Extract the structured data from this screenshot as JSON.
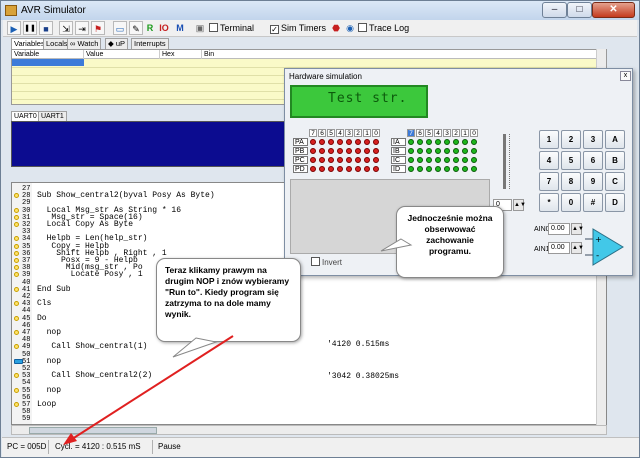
{
  "window": {
    "title": "AVR Simulator",
    "min": "–",
    "max": "□",
    "close": "✕"
  },
  "toolbar": {
    "play": "▶",
    "pause": "❚❚",
    "stop": "■",
    "rec": "R",
    "io": "IO",
    "mem": "M",
    "terminal": "Terminal",
    "sim_timers": "Sim Timers",
    "trace_log": "Trace Log",
    "sim_timers_checked": "✓"
  },
  "tabs": [
    "Variables",
    "Locals",
    "Watch",
    "uP",
    "Interrupts"
  ],
  "var_columns": [
    "Variable",
    "Value",
    "Hex",
    "Bin"
  ],
  "uart_tabs": [
    "UART0",
    "UART1"
  ],
  "code": {
    "lines": [
      {
        "n": "27",
        "t": ""
      },
      {
        "n": "28",
        "t": "Sub Show_central2(byval Posy As Byte)"
      },
      {
        "n": "29",
        "t": ""
      },
      {
        "n": "30",
        "t": "  Local Msg_str As String * 16"
      },
      {
        "n": "31",
        "t": "   Msg_str = Space(16)"
      },
      {
        "n": "32",
        "t": "  Local Copy As Byte"
      },
      {
        "n": "33",
        "t": ""
      },
      {
        "n": "34",
        "t": "  Helpb = Len(help_str)"
      },
      {
        "n": "35",
        "t": "   Copy = Helpb"
      },
      {
        "n": "36",
        "t": "    Shift Helpb , Right , 1"
      },
      {
        "n": "37",
        "t": "     Posx = 9 - Helpb"
      },
      {
        "n": "38",
        "t": "      Mid(msg_str , Po"
      },
      {
        "n": "39",
        "t": "       Locate Posy , 1"
      },
      {
        "n": "40",
        "t": ""
      },
      {
        "n": "41",
        "t": "End Sub"
      },
      {
        "n": "42",
        "t": ""
      },
      {
        "n": "43",
        "t": "Cls"
      },
      {
        "n": "44",
        "t": ""
      },
      {
        "n": "45",
        "t": "Do"
      },
      {
        "n": "46",
        "t": ""
      },
      {
        "n": "47",
        "t": "  nop"
      },
      {
        "n": "48",
        "t": ""
      },
      {
        "n": "49",
        "t": "   Call Show_central(1)"
      },
      {
        "n": "50",
        "t": ""
      },
      {
        "n": "51",
        "t": "  nop"
      },
      {
        "n": "52",
        "t": ""
      },
      {
        "n": "53",
        "t": "   Call Show_central2(2)"
      },
      {
        "n": "54",
        "t": ""
      },
      {
        "n": "55",
        "t": "  nop"
      },
      {
        "n": "56",
        "t": ""
      },
      {
        "n": "57",
        "t": "Loop"
      },
      {
        "n": "58",
        "t": ""
      },
      {
        "n": "59",
        "t": ""
      }
    ],
    "timing1": "'4120 0.515ms",
    "timing2": "'3042 0.38025ms"
  },
  "status": {
    "pc": "PC = 005D",
    "cycles": "Cycl. = 4120 : 0.515 mS",
    "state": "Pause"
  },
  "hw": {
    "title": "Hardware simulation",
    "close": "x",
    "lcd_text": "Test str.",
    "ports_left": [
      "PA",
      "PB",
      "PC",
      "PD"
    ],
    "ports_right": [
      "IA",
      "IB",
      "IC",
      "ID"
    ],
    "bits": [
      "7",
      "6",
      "5",
      "4",
      "3",
      "2",
      "1",
      "0"
    ],
    "invert": "Invert",
    "slider_value": "0",
    "keypad": [
      "1",
      "2",
      "3",
      "A",
      "4",
      "5",
      "6",
      "B",
      "7",
      "8",
      "9",
      "C",
      "*",
      "0",
      "#",
      "D"
    ],
    "ain0_label": "AIN0",
    "ain0_value": "0.00",
    "ain1_label": "AIN1",
    "ain1_value": "0.00",
    "plus": "+",
    "minus": "-"
  },
  "callouts": {
    "c1": "Jednocześnie można obserwować zachowanie programu.",
    "c2": "Teraz klikamy prawym na drugim NOP i znów wybieramy \"Run to\". Kiedy program się zatrzyma to na dole mamy wynik."
  },
  "colors": {
    "accent": "#3d7bd9",
    "uart_bg": "#0c0c90",
    "lcd_bg": "#3cc83c",
    "led_red": "#d62020",
    "led_green": "#1cb61c",
    "arrow": "#e02020"
  }
}
